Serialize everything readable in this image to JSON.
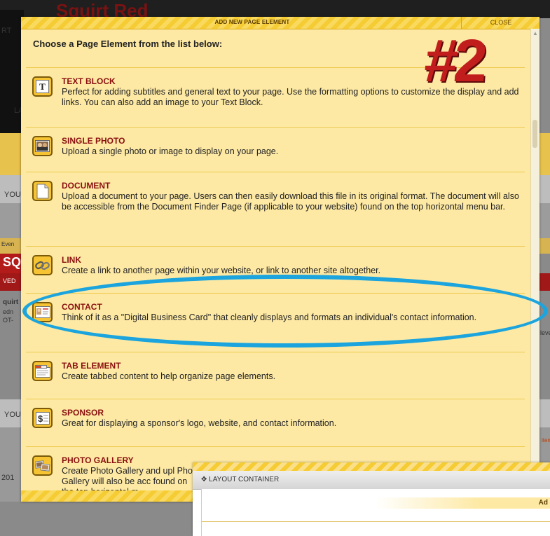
{
  "background": {
    "brand_text": "Squirt Red",
    "snips": [
      "RT",
      "LA",
      "YOU",
      "Even",
      "SQU",
      "VED",
      "quirt",
      "edn",
      "OT-",
      "YOU",
      "201",
      "leve",
      "item"
    ]
  },
  "modal": {
    "title": "ADD NEW PAGE ELEMENT",
    "close_label": "CLOSE",
    "intro": "Choose a Page Element from the list below:",
    "items": [
      {
        "name": "TEXT BLOCK",
        "icon": "text-block-icon",
        "desc": "Perfect for adding subtitles and general text to your page. Use the formatting options to customize the display and add links. You can also add an image to your Text Block."
      },
      {
        "name": "SINGLE PHOTO",
        "icon": "single-photo-icon",
        "desc": "Upload a single photo or image to display on your page."
      },
      {
        "name": "DOCUMENT",
        "icon": "document-icon",
        "desc": "Upload a document to your page. Users can then easily download this file in its original format. The document will also be accessible from the Document Finder Page (if applicable to your website) found on the top horizontal menu bar."
      },
      {
        "name": "LINK",
        "icon": "link-icon",
        "desc": "Create a link to another page within your website, or link to another site altogether."
      },
      {
        "name": "CONTACT",
        "icon": "contact-icon",
        "desc": "Think of it as a \"Digital Business Card\" that cleanly displays and formats an individual's contact information."
      },
      {
        "name": "TAB ELEMENT",
        "icon": "tab-element-icon",
        "desc": "Create tabbed content to help organize page elements."
      },
      {
        "name": "SPONSOR",
        "icon": "sponsor-icon",
        "desc": "Great for displaying a sponsor's logo, website, and contact information."
      },
      {
        "name": "PHOTO GALLERY",
        "icon": "photo-gallery-icon",
        "desc": "Create Photo Gallery and upl Photo Gallery will also be acc found on the top horizontal m"
      }
    ]
  },
  "annotation": {
    "label": "#2",
    "highlight_color": "#1ba4dd",
    "label_color": "#c21d1d"
  },
  "layout_container": {
    "title": "LAYOUT CONTAINER",
    "add_label": "Ad"
  },
  "colors": {
    "modal_bg": "#fde9a4",
    "header_stripe": "#f6cc35",
    "item_title": "#8a0f0f"
  }
}
